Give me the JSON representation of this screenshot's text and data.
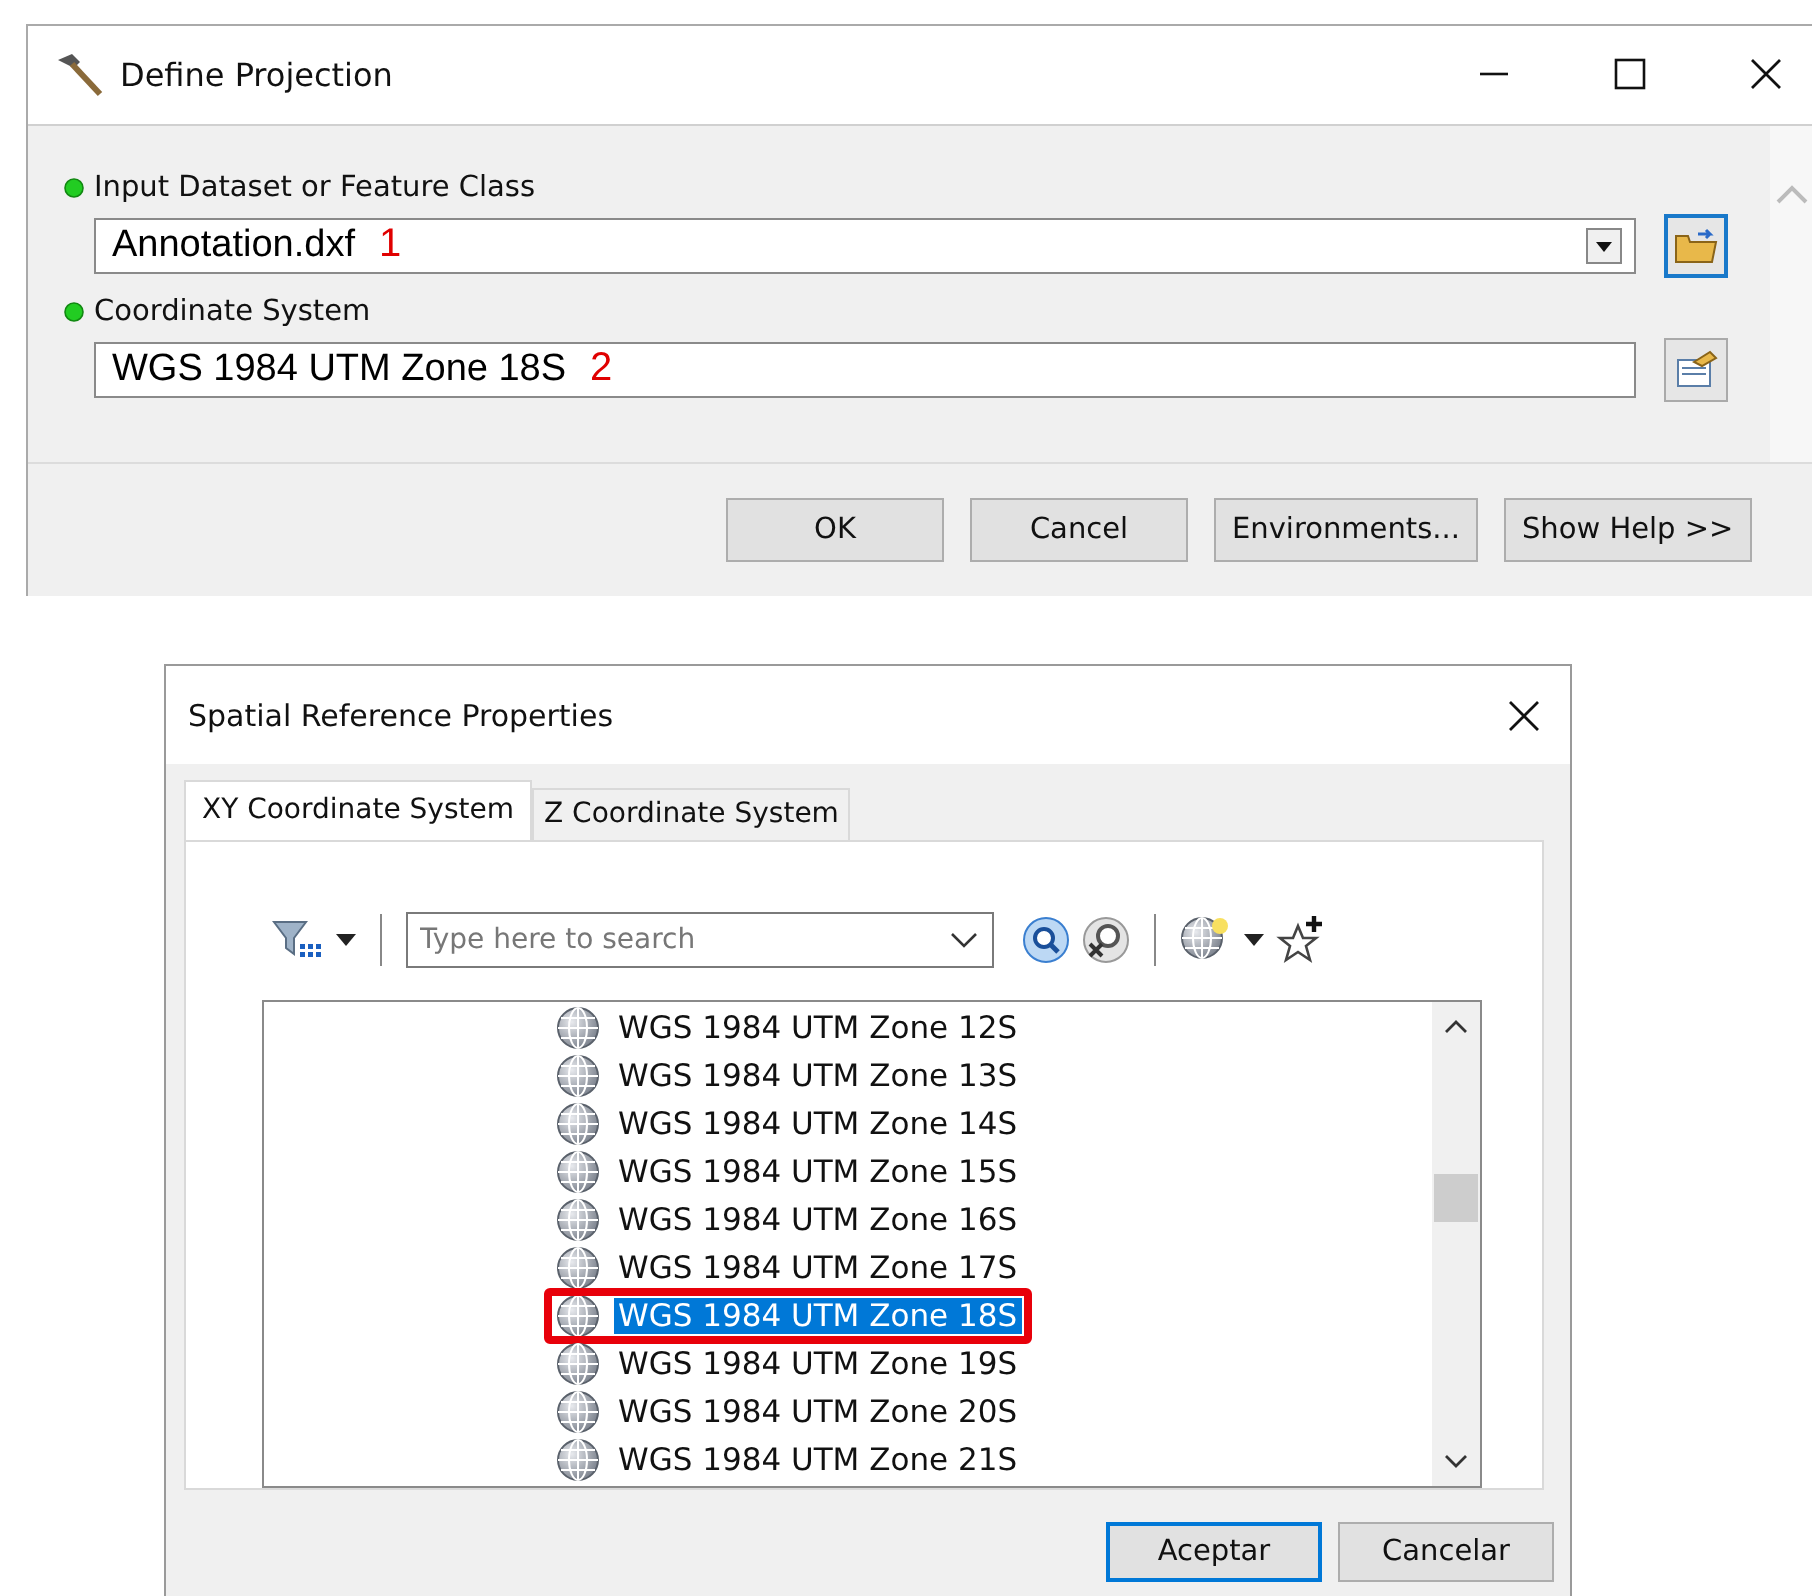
{
  "define_projection": {
    "title": "Define Projection",
    "fields": [
      {
        "kind": "dropdown",
        "label": "Input Dataset or Feature Class",
        "value": "Annotation.dxf",
        "annotation": "1",
        "browse_focused": true
      },
      {
        "kind": "text",
        "label": "Coordinate System",
        "value": "WGS 1984 UTM Zone 18S",
        "annotation": "2",
        "browse_focused": false
      }
    ],
    "buttons": [
      "OK",
      "Cancel",
      "Environments...",
      "Show Help >>"
    ]
  },
  "spatial_reference": {
    "title": "Spatial Reference Properties",
    "tabs": [
      {
        "label": "XY Coordinate System",
        "selected": true
      },
      {
        "label": "Z Coordinate System",
        "selected": false
      }
    ],
    "search": {
      "placeholder": "Type here to search"
    },
    "items": [
      {
        "label": "WGS 1984 UTM Zone 12S",
        "selected": false,
        "outlined": false
      },
      {
        "label": "WGS 1984 UTM Zone 13S",
        "selected": false,
        "outlined": false
      },
      {
        "label": "WGS 1984 UTM Zone 14S",
        "selected": false,
        "outlined": false
      },
      {
        "label": "WGS 1984 UTM Zone 15S",
        "selected": false,
        "outlined": false
      },
      {
        "label": "WGS 1984 UTM Zone 16S",
        "selected": false,
        "outlined": false
      },
      {
        "label": "WGS 1984 UTM Zone 17S",
        "selected": false,
        "outlined": false
      },
      {
        "label": "WGS 1984 UTM Zone 18S",
        "selected": true,
        "outlined": true
      },
      {
        "label": "WGS 1984 UTM Zone 19S",
        "selected": false,
        "outlined": false
      },
      {
        "label": "WGS 1984 UTM Zone 20S",
        "selected": false,
        "outlined": false
      },
      {
        "label": "WGS 1984 UTM Zone 21S",
        "selected": false,
        "outlined": false
      }
    ],
    "buttons": [
      {
        "label": "Aceptar",
        "default": true
      },
      {
        "label": "Cancelar",
        "default": false
      }
    ]
  }
}
